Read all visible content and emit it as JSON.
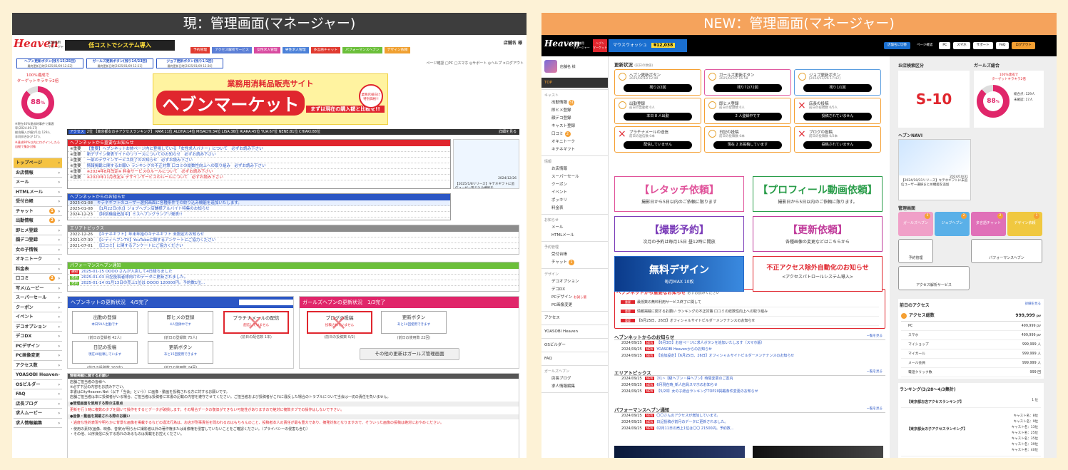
{
  "left": {
    "header": "現：管理画面(マネージャー)",
    "logo_text": "Heaven",
    "logo_sub": "店舗様用\nマネージャー",
    "promo_banner": "低コストでシステム導入",
    "store_name": "店舗名 様",
    "top_buttons": [
      "予約管理",
      "アクセス解析サービス",
      "女性求人管理",
      "男性求人管理",
      "多言語チャット",
      "パフォーマンスヘブン",
      "デザイン依頼"
    ],
    "top_button_colors": [
      "#e03a2f",
      "#5b7fd6",
      "#d84aa0",
      "#4a80d8",
      "#e03a2f",
      "#6bbf3a",
      "#f0a030"
    ],
    "update_buttons": [
      "ヘブン更新ボタン(残り15/25回)",
      "ガールズ更新ボタン(残り14/23回)",
      "ジョブ更新ボタン(残り1/1回)"
    ],
    "update_dates": [
      "最終更新日時[2025/01/09 12:22]",
      "最終更新日時[2025/01/09 12:11]",
      "最終更新日時[2025/01/09 12:30]"
    ],
    "page_links": "ページ確認 □PC □スマホ ◎サポート ◎ヘルプ ×ログアウト",
    "gauge_title": "100%達成で\nターゲットキラキラ2倍",
    "gauge_value": "88",
    "gauge_unit": "%",
    "gauge_note": "※現在40%達成時事件で集客\n率(2024.09.27)\n総合購入が値が1位 129人\n非同伴合計が 17人",
    "gauge_note2": "※達成90%以内にログインしたら自動で集計対象",
    "nav": [
      "トップページ",
      "お店情報",
      "メール",
      "HTMLメール",
      "受付台帳",
      "チャット",
      "出勤情報",
      "即ヒメ登録",
      "顔デコ登録",
      "女の子情報",
      "オキニトーク",
      "料金表",
      "口コミ",
      "写メ/ムービー",
      "スーパーセール",
      "クーポン",
      "イベント",
      "デコオプション",
      "デコDX",
      "PCデザイン",
      "PC画像変更",
      "アクセス数",
      "YOASOBI Heaven",
      "OSビルダー",
      "FAQ",
      "店長ブログ",
      "求人ムービー",
      "求人情報編集"
    ],
    "nav_badges": {
      "チャット": "1",
      "出勤情報": "2",
      "口コミ": "2"
    },
    "ad_title": "業務用消耗品販売サイト",
    "ad_main": "ヘブンマーケット",
    "ad_sub": "まずは現在の購入額と比較を!!",
    "ad_badge": "業務店様向け\n特別価格!!",
    "access_label": "アクセス",
    "access_text": "2位 【東京都女の子アクセスランキング】 RAM:11位 ALOHA:14位 MISACHI:34位 LISA:36位 RIARA:45位 YUA:67位 NENE:81位 CHIAKI:88位",
    "detail_link": "詳細を見る",
    "important_title": "ヘブンネットから重要なお知らせ",
    "important": [
      {
        "tag": "※重要",
        "text": "【重要】ヘブンネットお姉ページ内に登場している「女性求人バナー」について　必ずお読み下さい"
      },
      {
        "tag": "※重要",
        "text": "新デザイン発表サイトのリリースについてのお知らせ　必ずお読み下さい"
      },
      {
        "tag": "※重要",
        "text": "一部のデザインサービス終了のお知らせ　必ずお読み下さい"
      },
      {
        "tag": "※重要",
        "text": "情報掲載に関するお願い ランキングの不正対策 口コミの総数性向上への取り組み　必ずお読み下さい"
      },
      {
        "tag": "※重要",
        "text": "※2024年8月改定※ 料金サービスのルールについて　必ずお読み下さい"
      },
      {
        "tag": "※重要",
        "text": "※2020年11月改定※ デザインサービスのルールについて　必ずお読み下さい"
      }
    ],
    "side_ad_date": "2024/12/26",
    "side_ad_text": "【2025/1/8リリース】キテネギフトに追信ユーザー覧り込み機能を...",
    "net_news_title": "ヘブンネットからのお知らせ",
    "net_news": [
      {
        "date": "2025-01-08",
        "text": "キテネギフトのユーザー選択画面に各種条件での絞り込み機能を追加いたします。"
      },
      {
        "date": "2025-01-08",
        "text": "【1月22日(水)】ジョブヘブン店舗様アルバイト特集のお知らせ"
      },
      {
        "date": "2024-12-23",
        "text": "【特別機能追加中】ミスヘブングランプリ発表!!"
      }
    ],
    "area_title": "エリアトピックス",
    "area": [
      {
        "date": "2022-12-26",
        "text": "【キテネギフト】年末年始のキテネギフト 未設定のお知らせ"
      },
      {
        "date": "2021-07-30",
        "text": "【シティヘブンTV】YouTubeに関するアンケートにご協力ください"
      },
      {
        "date": "2021-07-01",
        "text": "【口コミ】に関するアンケートにご協力ください"
      }
    ],
    "perf_title": "パフォーマンスヘブン通知",
    "perf": [
      {
        "tag": "通知",
        "text": "2025-01-15  OOOO さんが入店して4日経ちました"
      },
      {
        "tag": "更新",
        "text": "2025-01-03  日記投稿者様向けのデータに更新されました。"
      },
      {
        "tag": "更新",
        "text": "2025-01-14  01月13日の売上1位は OOOO 120000円。予約数1位..."
      }
    ],
    "heaven_status": "ヘブンネットの更新状況　4/5完了",
    "girls_status": "ガールズヘブンの更新状況　1/3完了",
    "heaven_cards": [
      {
        "t": "出勤の登録",
        "s": "本日59人出勤です",
        "sub": "(前日の登録者 42人)"
      },
      {
        "t": "即ヒメの登録",
        "s": "4人登録中です",
        "sub": "(前日の登録数 75人)"
      },
      {
        "t": "プラチナメールの配信",
        "s": "配信していません",
        "sub": "(前日の配信数 1本)"
      },
      {
        "t": "日記の投稿",
        "s": "現在40投稿しています",
        "sub": "(前日の投稿数 163本)"
      },
      {
        "t": "更新ボタン",
        "s": "あと15回使用できます",
        "sub": "(前日の使用数 24回)"
      }
    ],
    "girls_cards": [
      {
        "t": "ブログの投稿",
        "s": "投稿されていません",
        "sub": "(前日の投稿数 0/2)"
      },
      {
        "t": "更新ボタン",
        "s": "あと14回使用できます",
        "sub": "(前日の使用数 22回)"
      }
    ],
    "girls_button": "その他の更新はガールズ管理画面",
    "notice_title": "情報掲載に関するお願い",
    "notice_lines": [
      "店舗ご担当者の皆様へ",
      "※必ず下記の内容をお読み下さい。",
      "本書はCityHeaven.Net（以下「当会」という）に画像・動画を投稿される方に対するお願いです。",
      "店舗ご担当者は本に投稿者がいる場合、ご担当者は投稿者に本書の記載の内容を遵守させてください。ご担当者および投稿者がこれに違反した場合のトラブルについて当会は一切の責任を負いません。"
    ],
    "notice_h1": "●管理画面を使用する際の注意点",
    "notice_r1": "更新を行う時に複数のタブを開いて操作をするとデータが破損します。その場合データの復旧ができない可能性がありますので絶対に複数タブでの操作はしないで下さい。",
    "notice_h2": "●画像・動画を掲載される際のお願い",
    "notice_r2": "・過度な性的表現や明らかに背景な画像を掲載するなどの違法行為は、お店が刑事責任を問われるのはもちろんのこと、投稿者本人の責任が最も重大であり、摘発対象となりますので、そういった画像の投稿は絶対におやめください。",
    "notice_l3": "・使用の素材(画像、映像、音楽)が明らかに撮影者以外の著作権または肖像権を侵害していないことをご確認ください。（プライバシーの侵害も含む）",
    "notice_l4": "・その他、公序良俗に反する恐れのあるものは掲載をお控えください。"
  },
  "right": {
    "header": "NEW：管理画面(マネージャー)",
    "logo_text": "Heaven",
    "logo_sub": "店舗様用\nマネージャー",
    "promo1": "ヘブン\nマーケット",
    "promo2": "マウスウォッシュ",
    "promo2_price": "¥12,038",
    "top_buttons": [
      "店舗名に切替",
      "ページ確認",
      "PC",
      "スマホ",
      "サポート",
      "FAQ",
      "ログアウト"
    ],
    "store_name": "店舗名 様",
    "nav_groups": [
      {
        "h": "",
        "items": [
          "TOP"
        ]
      },
      {
        "h": "キャスト",
        "items": [
          "出勤情報",
          "即ヒメ登録",
          "顔デコ登録",
          "キャスト登録",
          "口コミ",
          "オキニトーク",
          "キテネギフト"
        ]
      },
      {
        "h": "情報",
        "items": [
          "お店情報",
          "スーパーセール",
          "クーポン",
          "イベント",
          "ポッキリ",
          "料金表"
        ]
      },
      {
        "h": "お知らせ",
        "items": [
          "メール",
          "HTMLメール"
        ]
      },
      {
        "h": "予約管理",
        "items": [
          "受付台帳",
          "チャット"
        ]
      },
      {
        "h": "デザイン",
        "items": [
          "デコオプション",
          "デコDX",
          "PCデザイン",
          "PC画像変更"
        ]
      },
      {
        "h": "",
        "items": [
          "アクセス"
        ]
      },
      {
        "h": "",
        "items": [
          "YOASOBI Heaven"
        ]
      },
      {
        "h": "",
        "items": [
          "OSビルダー"
        ]
      },
      {
        "h": "",
        "items": [
          "FAQ"
        ]
      },
      {
        "h": "ガールズヘブン",
        "items": [
          "店長ブログ",
          "求人情報編集"
        ]
      }
    ],
    "nav_badges": {
      "出勤情報": "31",
      "口コミ": "2",
      "チャット": "1"
    },
    "nav_note": {
      "PCデザイン": "お試し版"
    },
    "status_title": "更新状況",
    "status_sub": "(前日の数値)",
    "cards": [
      {
        "t": "ヘブン更新ボタン",
        "d": "2025/02/18 12:40",
        "b": "残り2/2回",
        "x": false,
        "bc": "#f5a033"
      },
      {
        "t": "ガールズ更新ボタン",
        "d": "2025/02/07 16:58",
        "b": "残り72/72回",
        "x": false,
        "bc": "#e05aa0"
      },
      {
        "t": "ジョブ更新ボタン",
        "d": "[2024/11/26 17:42]",
        "b": "残り1/1回",
        "x": false,
        "bc": "#5a9de0"
      },
      {
        "t": "出勤登録",
        "d": "前日の出勤者 0人",
        "b": "本日 8 人出勤",
        "x": false,
        "bc": "#f5a033"
      },
      {
        "t": "即ヒメ登録",
        "d": "前日の登録数 0人",
        "b": "2 人登録中です",
        "x": false,
        "bc": "#f5a033"
      },
      {
        "t": "店長の投稿",
        "d": "前日の投稿数 0/5人",
        "b": "投稿されていません",
        "x": true,
        "bc": "#f5a033"
      },
      {
        "t": "プラチナメールの送信",
        "d": "前日の送信数 0本",
        "b": "配信していません",
        "x": true,
        "bc": "#f5a033"
      },
      {
        "t": "日記の投稿",
        "d": "前日の投稿数 0本",
        "b": "現在 2 本投稿しています",
        "x": false,
        "bc": "#f5a033"
      },
      {
        "t": "ブログの投稿",
        "d": "前日の投稿数 0/2本",
        "b": "投稿されていません",
        "x": true,
        "bc": "#f5a033"
      }
    ],
    "banners": [
      {
        "t": "【レタッチ依頼】",
        "s": "撮影日から5日以内のご依頼に限ります",
        "c": "#e0529a"
      },
      {
        "t": "【プロフィール動画依頼】",
        "s": "撮影日から5日以内のご依頼に限ります。",
        "c": "#2a9d4a"
      },
      {
        "t": "【撮影予約】",
        "s": "次月の予約は毎月15日 昼12時に開放",
        "c": "#7a3bb8"
      },
      {
        "t": "【更新依頼】",
        "s": "各種画像の変更などはこちらから",
        "c": "#c03a9a"
      },
      {
        "t": "無料デザイン",
        "s": "毎月MAX 10枚",
        "c": "#2567c8"
      },
      {
        "t": "不正アクセス除外自動化のお知らせ",
        "s": "<アクセスパトロールシステム導入>",
        "c": "#e0262e"
      }
    ],
    "important_title": "ヘブンネットから重要なお知らせ",
    "important_sub": "必ずお読みください",
    "important": [
      "最低数の無料利用サービス終了に関して",
      "情報掲載に関するお願い ランキングの不正対策 口コミの総数性向上への取り組み",
      "【6月25日、26日】オフィシャルサイトビルダーメンテナンスのお知らせ"
    ],
    "important_tag": "重要",
    "net_news_title": "ヘブンネットからのお知らせ",
    "more": "一覧を見る",
    "net_news": [
      {
        "d": "2024/09/25",
        "t": "【6月3日】お店ページに求人ボタンを追加いたします（スマホ版）"
      },
      {
        "d": "2024/09/25",
        "t": "YOASOBI Heavenからのお知らせ"
      },
      {
        "d": "2024/09/25",
        "t": "【追加設定】【6月25日、26日】オフィシャルサイトビルダーメンテナンスのお知らせ"
      }
    ],
    "area_title": "エリアトピックス",
    "area": [
      {
        "d": "2024/09/25",
        "t": "7/1~【級ヘブン・得ヘブン】時間変更のご案内"
      },
      {
        "d": "2024/09/25",
        "t": "6月現在時_新人店員スマホのお知らせ"
      },
      {
        "d": "2024/09/25",
        "t": "【5/20】女の子総合ランキングTOP20掲載条件変更のお知らせ"
      }
    ],
    "perf_title": "パフォーマンスヘブン通知",
    "perf": [
      {
        "d": "2024/09/25",
        "t": "〇〇さんのアクセスが増加しています。"
      },
      {
        "d": "2024/09/25",
        "t": "日記投稿が前月のデータに更新されました。"
      },
      {
        "d": "2024/09/25",
        "t": "02月11日の売上1位は〇〇 21500円。予約数..."
      }
    ],
    "new_tag": "NEW",
    "store_cat_title": "お店検索区分",
    "store_cat": "S-10",
    "girls_title": "ガールズ総合",
    "gauge_title": "100%達成で\nターゲットキラキラ2倍",
    "gauge_value": "88",
    "gauge_unit": "%",
    "gauge_stats": [
      "総合点: 129人",
      "未確認: 17人"
    ],
    "navi_title": "ヘブンNAVI",
    "navi_date": "2024/10/31",
    "navi_text": "【2024/10/31リリース】キテネギフトに未追信ユーザー選択まとめ機能を追加",
    "mgmt_title": "管理画面",
    "tiles": [
      {
        "t": "ガールズヘブン",
        "c": "#f0a0c8",
        "b": "5"
      },
      {
        "t": "ジョブヘブン",
        "c": "#5ab0e8",
        "b": "2"
      },
      {
        "t": "多言語チャット",
        "c": "#e070b8",
        "b": "2"
      },
      {
        "t": "デザイン依頼",
        "c": "#f0c840",
        "b": "1"
      }
    ],
    "tiles2": [
      "予約管理",
      "パフォーマンスヘブン",
      "アクセス解析サービス"
    ],
    "access_title": "前日のアクセス",
    "access_detail": "詳細を見る",
    "access_total_label": "アクセス総数",
    "access_total": "999,999",
    "access_unit": "pv",
    "access_rows": [
      {
        "l": "PC",
        "v": "499,999 pv"
      },
      {
        "l": "スマホ",
        "v": "499,999 pv"
      },
      {
        "l": "マイショップ",
        "v": "999,999 人"
      },
      {
        "l": "マイガール",
        "v": "999,999 人"
      },
      {
        "l": "メール会員",
        "v": "999,999 人"
      },
      {
        "l": "電話クリック数",
        "v": "999 回"
      }
    ],
    "ranking_title": "ランキング(3/28～4/3集計)",
    "rankings": [
      {
        "t": "【東京都お店アクセスランキング】",
        "v": "1 位"
      },
      {
        "t": "【東京都女の子アクセスランキング】",
        "v": "キャスト名：8位\nキャスト名：9位\nキャスト名：13位\nキャスト名：25位\nキャスト名：35位\nキャスト名：39位\nキャスト名：40位"
      }
    ]
  }
}
